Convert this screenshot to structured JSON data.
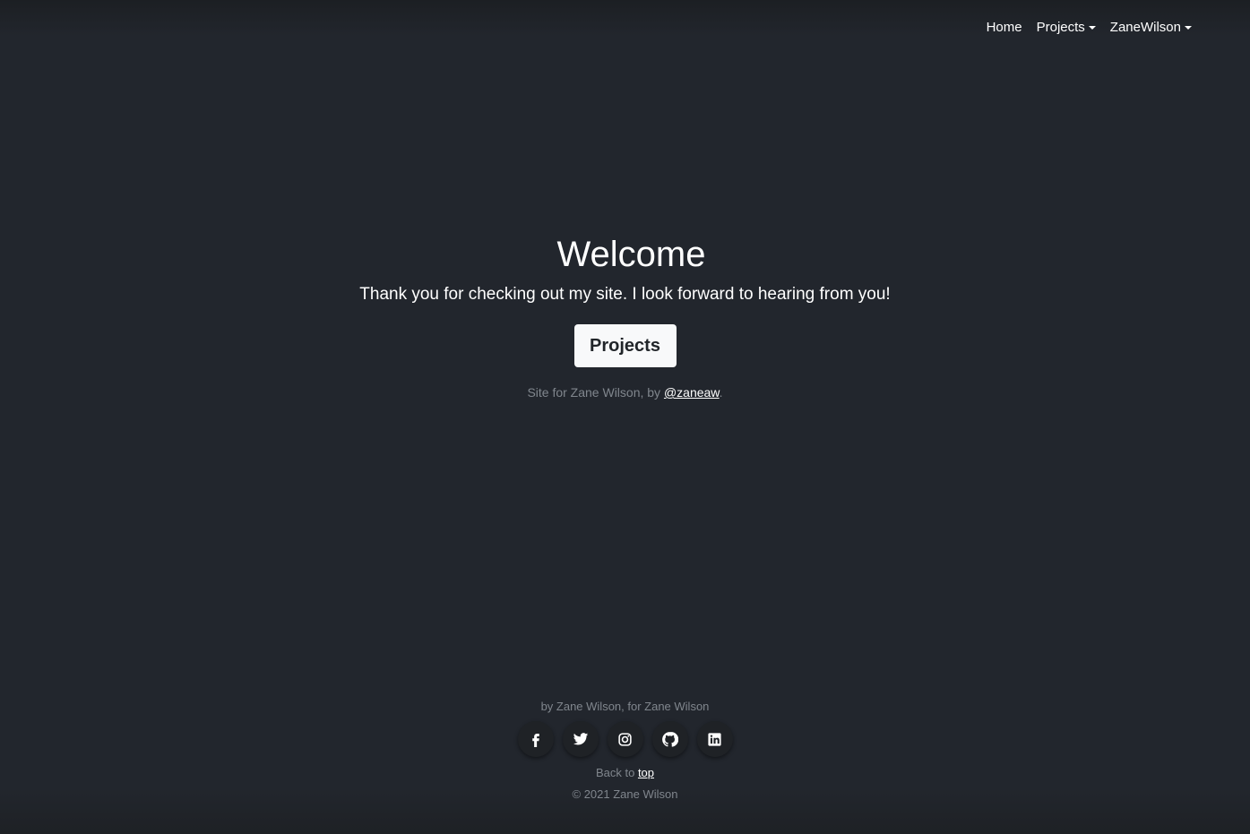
{
  "nav": {
    "items": [
      {
        "label": "Home",
        "has_dropdown": false
      },
      {
        "label": "Projects",
        "has_dropdown": true
      },
      {
        "label": "ZaneWilson",
        "has_dropdown": true
      }
    ]
  },
  "hero": {
    "title": "Welcome",
    "lead": "Thank you for checking out my site. I look forward to hearing from you!",
    "button_label": "Projects",
    "credit_prefix": "Site for Zane Wilson, by ",
    "credit_link": "@zaneaw",
    "credit_suffix": "."
  },
  "footer": {
    "tagline": "by Zane Wilson, for Zane Wilson",
    "social": [
      {
        "icon": "facebook-icon"
      },
      {
        "icon": "twitter-icon"
      },
      {
        "icon": "instagram-icon"
      },
      {
        "icon": "github-icon"
      },
      {
        "icon": "linkedin-icon"
      }
    ],
    "back_prefix": "Back to ",
    "back_link": "top",
    "copyright": "© 2021 Zane Wilson"
  },
  "colors": {
    "background": "#22262d",
    "muted_text": "#80868d",
    "button_bg": "#f8f9fa",
    "button_text": "#212529"
  }
}
